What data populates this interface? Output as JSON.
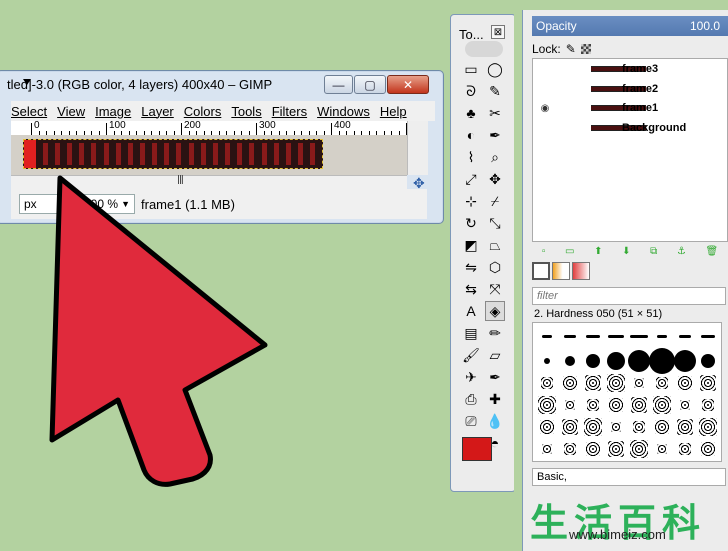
{
  "image_window": {
    "title": "tled]-3.0 (RGB color, 4 layers) 400x40 – GIMP",
    "min_glyph": "—",
    "max_glyph": "▢",
    "close_glyph": "✕",
    "menu": [
      "Select",
      "View",
      "Image",
      "Layer",
      "Colors",
      "Tools",
      "Filters",
      "Windows",
      "Help"
    ],
    "ruler_labels": [
      "0",
      "100",
      "200",
      "300",
      "400"
    ],
    "frame_count": 24,
    "hscroll_grip": "ꟾꟾꟾ",
    "status": {
      "unit": "px",
      "zoom": "100 %",
      "info": "frame1 (1.1 MB)"
    }
  },
  "toolbox": {
    "title": "To...",
    "close_glyph": "⊠",
    "tools": [
      [
        "rect-select-icon",
        "▭"
      ],
      [
        "ellipse-select-icon",
        "◯"
      ],
      [
        "lasso-icon",
        "ᘐ"
      ],
      [
        "fuzzy-select-icon",
        "✎"
      ],
      [
        "color-select-icon",
        "♣"
      ],
      [
        "scissors-icon",
        "✂"
      ],
      [
        "foreground-select-icon",
        "◐"
      ],
      [
        "paths-icon",
        "✒"
      ],
      [
        "color-picker-icon",
        "⌇"
      ],
      [
        "zoom-icon",
        "⌕"
      ],
      [
        "measure-icon",
        "⤢"
      ],
      [
        "move-icon",
        "✥"
      ],
      [
        "align-icon",
        "⊹"
      ],
      [
        "crop-icon",
        "⌿"
      ],
      [
        "rotate-icon",
        "↻"
      ],
      [
        "scale-icon",
        "⤡"
      ],
      [
        "shear-icon",
        "◩"
      ],
      [
        "perspective-icon",
        "⏢"
      ],
      [
        "flip-icon",
        "⇋"
      ],
      [
        "cage-icon",
        "⬡"
      ],
      [
        "warp-icon",
        "⇆"
      ],
      [
        "unified-transform-icon",
        "⤧"
      ],
      [
        "text-icon",
        "A"
      ],
      [
        "bucket-fill-icon",
        "◈"
      ],
      [
        "blend-icon",
        "▤"
      ],
      [
        "pencil-icon",
        "✏"
      ],
      [
        "paintbrush-icon",
        "🖌"
      ],
      [
        "eraser-icon",
        "▱"
      ],
      [
        "airbrush-icon",
        "✈"
      ],
      [
        "ink-icon",
        "✒"
      ],
      [
        "clone-icon",
        "⎙"
      ],
      [
        "heal-icon",
        "✚"
      ],
      [
        "perspective-clone-icon",
        "⎚"
      ],
      [
        "blur-icon",
        "💧"
      ],
      [
        "smudge-icon",
        "☝"
      ],
      [
        "dodge-burn-icon",
        "◓"
      ]
    ],
    "fg_color": "#d41818",
    "bg_color": "#ffffff"
  },
  "layers": {
    "opacity_label": "Opacity",
    "opacity_value": "100.0",
    "lock_label": "Lock:",
    "items": [
      {
        "name": "frame3",
        "visible": false
      },
      {
        "name": "frame2",
        "visible": false
      },
      {
        "name": "frame1",
        "visible": true
      },
      {
        "name": "Background",
        "visible": false
      }
    ],
    "buttons": [
      "▫",
      "▭",
      "⬆",
      "⬇",
      "⧉",
      "⚓",
      "🗑"
    ]
  },
  "brushes": {
    "filter_placeholder": "filter",
    "current_brush": "2. Hardness 050 (51 × 51)",
    "preset": "Basic,"
  },
  "watermark": {
    "chars": "生活百科",
    "url": "www.bimeiz.com"
  }
}
